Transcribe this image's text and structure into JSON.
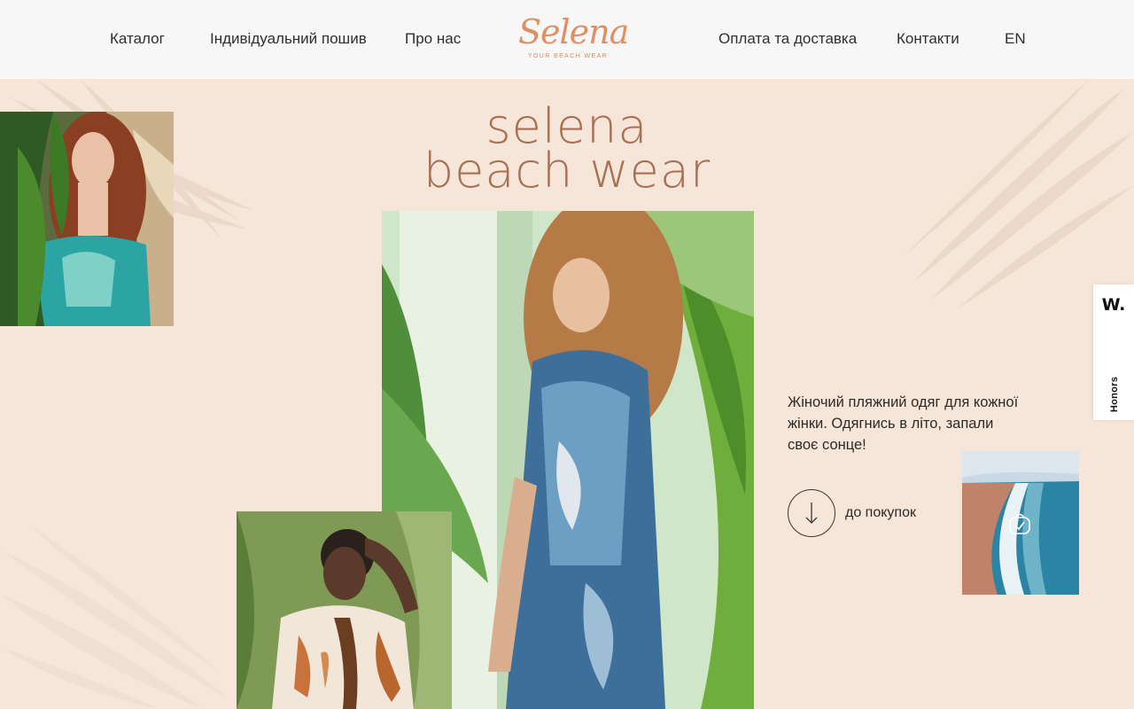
{
  "nav": {
    "left": [
      "Каталог",
      "Індивідуальний пошив",
      "Про нас"
    ],
    "right": [
      "Оплата та доставка",
      "Контакти"
    ],
    "lang": "EN"
  },
  "logo": {
    "word": "Selena",
    "tagline": "YOUR BEACH WEAR"
  },
  "hero": {
    "line1": "selena",
    "line2": "beach wear"
  },
  "tagline": "Жіночий пляжний одяг для кожної жінки. Одягнись в літо, запали своє сонце!",
  "cta": {
    "label": "до покупок",
    "icon": "arrow-down-icon"
  },
  "honors": {
    "mark": "W.",
    "label": "Honors"
  },
  "colors": {
    "background": "#f5e6d9",
    "header": "#f7f7f7",
    "accent": "#e08f63",
    "title": "#a86f53"
  }
}
